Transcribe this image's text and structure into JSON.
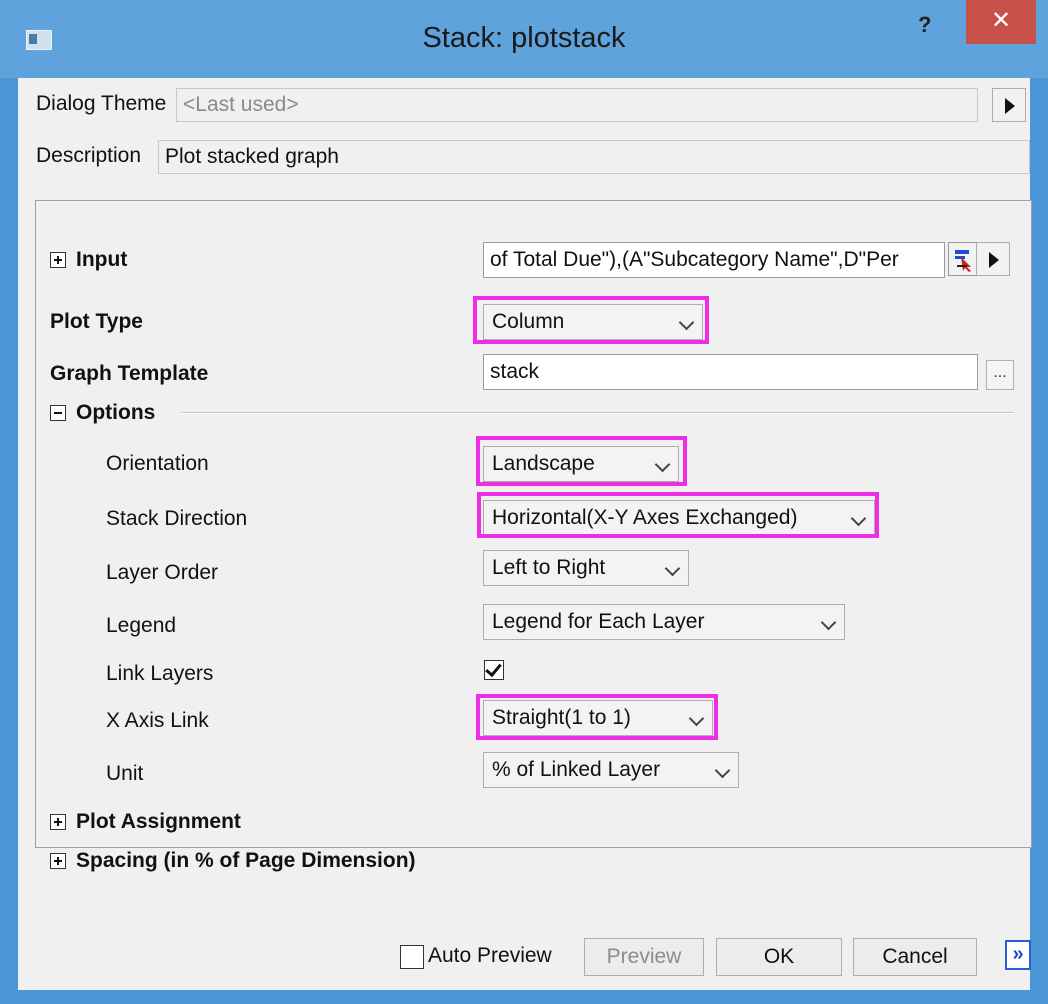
{
  "window": {
    "title": "Stack: plotstack",
    "help_glyph": "?",
    "close_glyph": "✕"
  },
  "header": {
    "theme_label": "Dialog Theme",
    "theme_value": "<Last used>",
    "description_label": "Description",
    "description_value": "Plot stacked graph"
  },
  "form": {
    "input_label": "Input",
    "input_value": "of Total Due\"),(A\"Subcategory Name\",D\"Per",
    "plot_type_label": "Plot Type",
    "plot_type_value": "Column",
    "graph_template_label": "Graph Template",
    "graph_template_value": "stack",
    "graph_template_browse": "...",
    "options_label": "Options",
    "orientation_label": "Orientation",
    "orientation_value": "Landscape",
    "stack_direction_label": "Stack Direction",
    "stack_direction_value": "Horizontal(X-Y Axes Exchanged)",
    "layer_order_label": "Layer Order",
    "layer_order_value": "Left to Right",
    "legend_label": "Legend",
    "legend_value": "Legend for Each Layer",
    "link_layers_label": "Link Layers",
    "link_layers_checked": true,
    "x_axis_link_label": "X Axis Link",
    "x_axis_link_value": "Straight(1 to 1)",
    "unit_label": "Unit",
    "unit_value": "% of Linked Layer",
    "plot_assignment_label": "Plot Assignment",
    "spacing_label": "Spacing (in % of Page Dimension)"
  },
  "footer": {
    "auto_preview_label": "Auto Preview",
    "auto_preview_checked": false,
    "preview_label": "Preview",
    "ok_label": "OK",
    "cancel_label": "Cancel",
    "more_glyph": "»"
  },
  "colors": {
    "highlight": "#ee2ee6",
    "titlebar": "#5ea3dc",
    "close": "#c7504a"
  }
}
